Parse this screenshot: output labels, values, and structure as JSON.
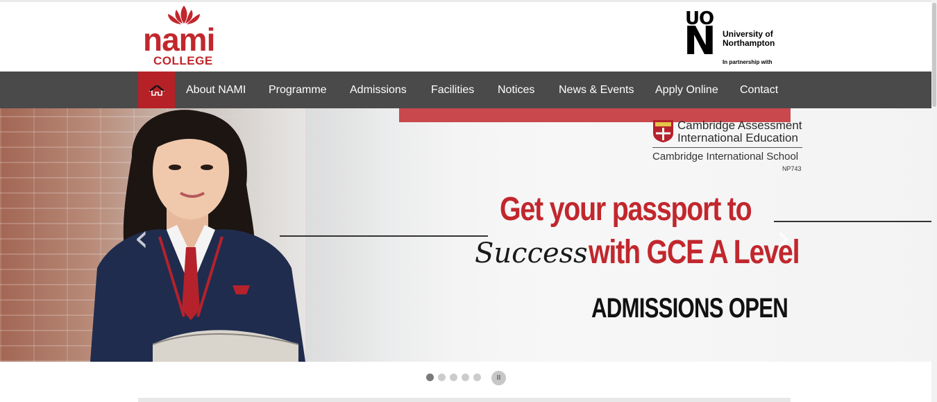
{
  "logo": {
    "word": "nami",
    "sub": "COLLEGE"
  },
  "partner": {
    "mark": [
      "U",
      "O",
      "N"
    ],
    "name": "University of\nNorthampton",
    "tagline": "In partnership with"
  },
  "nav": {
    "home_icon": "home-icon",
    "items": [
      "About NAMI",
      "Programme",
      "Admissions",
      "Facilities",
      "Notices",
      "News & Events",
      "Apply Online",
      "Contact"
    ]
  },
  "hero": {
    "cambridge": {
      "line1": "Cambridge Assessment",
      "line2": "International Education",
      "line3": "Cambridge International School",
      "code": "NP743"
    },
    "headline_line1": "Get your passport to",
    "script_word": "Success",
    "headline_line2": "with GCE A Level",
    "cta": "ADMISSIONS OPEN",
    "prev_icon": "chevron-left-icon",
    "next_icon": "chevron-right-icon"
  },
  "slider": {
    "slide_count": 5,
    "active_index": 0,
    "pause_label": "II"
  },
  "colors": {
    "brand_red": "#c1272d",
    "nav_bg": "#4a4a4a",
    "home_bg": "#b52126"
  }
}
